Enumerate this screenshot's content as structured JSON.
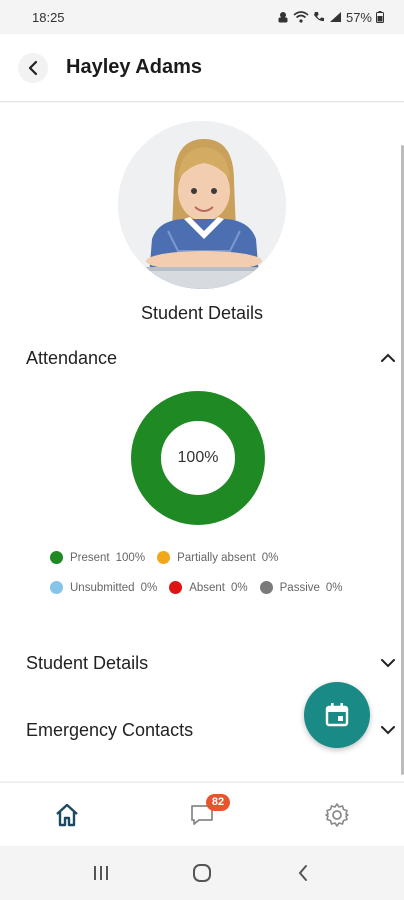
{
  "status_bar": {
    "time": "18:25",
    "battery": "57%"
  },
  "header": {
    "title": "Hayley Adams"
  },
  "profile": {
    "caption": "Student Details"
  },
  "sections": {
    "attendance": "Attendance",
    "student_details": "Student Details",
    "emergency_contacts": "Emergency Contacts"
  },
  "attendance": {
    "center_label": "100%",
    "legend": [
      {
        "label": "Present",
        "value": "100%",
        "color": "#1f8a24"
      },
      {
        "label": "Partially absent",
        "value": "0%",
        "color": "#f0a81a"
      },
      {
        "label": "Unsubmitted",
        "value": "0%",
        "color": "#86c5e8"
      },
      {
        "label": "Absent",
        "value": "0%",
        "color": "#e01212"
      },
      {
        "label": "Passive",
        "value": "0%",
        "color": "#7a7a7a"
      }
    ]
  },
  "bottom_nav": {
    "messages_badge": "82"
  },
  "colors": {
    "accent": "#1a8a86",
    "present": "#1f8a24",
    "badge": "#e8552d"
  }
}
